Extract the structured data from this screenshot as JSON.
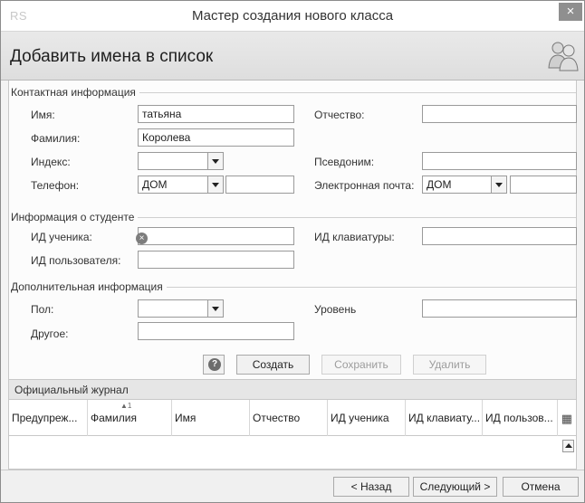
{
  "window": {
    "app_logo": "RS",
    "title": "Мастер создания нового класса",
    "close_symbol": "×"
  },
  "header": {
    "title": "Добавить имена в список",
    "icon": "people-icon"
  },
  "contact": {
    "group_title": "Контактная информация",
    "first_name_label": "Имя:",
    "first_name_value": "татьяна",
    "middle_name_label": "Отчество:",
    "middle_name_value": "",
    "last_name_label": "Фамилия:",
    "last_name_value": "Королева",
    "zip_label": "Индекс:",
    "zip_value": "",
    "nickname_label": "Псевдоним:",
    "nickname_value": "",
    "phone_label": "Телефон:",
    "phone_type": "ДОМ",
    "phone_value": "",
    "email_label": "Электронная почта:",
    "email_type": "ДОМ",
    "email_value": ""
  },
  "student": {
    "group_title": "Информация о студенте",
    "student_id_label": "ИД ученика:",
    "student_id_value": "",
    "keyboard_id_label": "ИД клавиатуры:",
    "keyboard_id_value": "",
    "user_id_label": "ИД пользователя:",
    "user_id_value": ""
  },
  "extra": {
    "group_title": "Дополнительная информация",
    "gender_label": "Пол:",
    "gender_value": "",
    "level_label": "Уровень",
    "level_value": "",
    "other_label": "Другое:",
    "other_value": ""
  },
  "actions": {
    "help_icon": "?",
    "create": "Создать",
    "save": "Сохранить",
    "delete": "Удалить"
  },
  "journal": {
    "title": "Официальный журнал",
    "sort_indicator": "▲1",
    "columns": [
      "Предупреж...",
      "Фамилия",
      "Имя",
      "Отчество",
      "ИД ученика",
      "ИД клавиату...",
      "ИД пользов..."
    ],
    "grid_icon": "▦"
  },
  "footer": {
    "back": "< Назад",
    "next": "Следующий >",
    "cancel": "Отмена"
  }
}
